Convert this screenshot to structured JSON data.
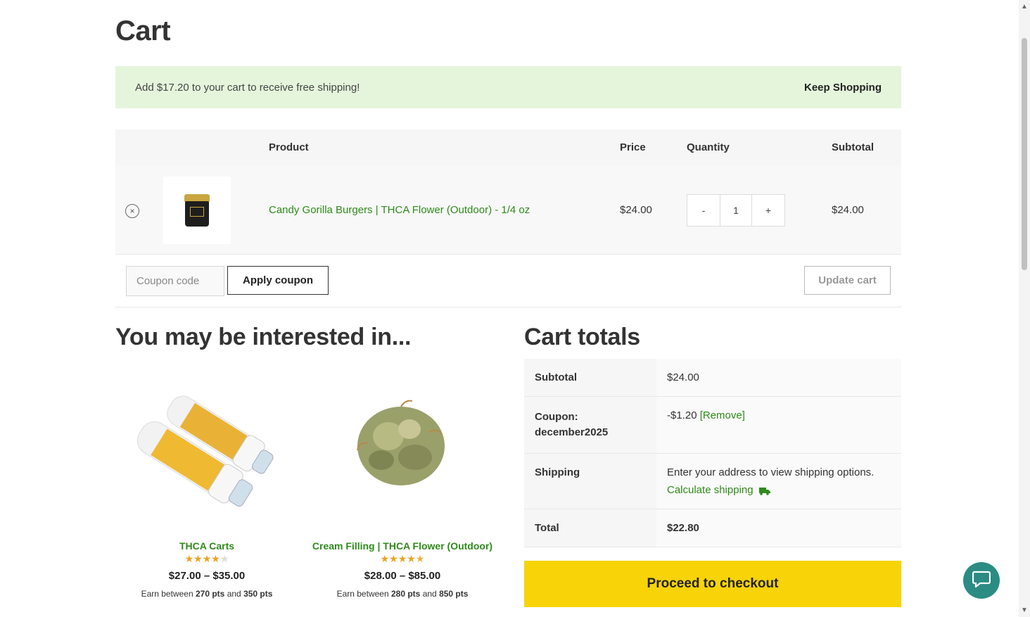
{
  "page": {
    "title": "Cart"
  },
  "notice": {
    "text": "Add $17.20 to your cart to receive free shipping!",
    "link": "Keep Shopping"
  },
  "cart": {
    "headers": {
      "product": "Product",
      "price": "Price",
      "quantity": "Quantity",
      "subtotal": "Subtotal"
    },
    "items": [
      {
        "name": "Candy Gorilla Burgers | THCA Flower (Outdoor) - 1/4 oz",
        "price": "$24.00",
        "quantity": "1",
        "subtotal": "$24.00",
        "thumbnail_icon": "product-jar-icon"
      }
    ],
    "qty_minus": "-",
    "qty_plus": "+",
    "remove_symbol": "×"
  },
  "actions": {
    "coupon_placeholder": "Coupon code",
    "apply_label": "Apply coupon",
    "update_label": "Update cart"
  },
  "related": {
    "title": "You may be interested in...",
    "products": [
      {
        "title": "THCA Carts",
        "rating": 4,
        "price": "$27.00 – $35.00",
        "points_prefix": "Earn between",
        "points_min": "270 pts",
        "points_and": "and",
        "points_max": "350 pts"
      },
      {
        "title": "Cream Filling | THCA Flower (Outdoor)",
        "rating": 4.5,
        "price": "$28.00 – $85.00",
        "points_prefix": "Earn between",
        "points_min": "280 pts",
        "points_and": "and",
        "points_max": "850 pts"
      }
    ]
  },
  "totals": {
    "title": "Cart totals",
    "subtotal_label": "Subtotal",
    "subtotal_value": "$24.00",
    "coupon_label": "Coupon: december2025",
    "coupon_value": "-$1.20",
    "coupon_remove": "[Remove]",
    "shipping_label": "Shipping",
    "shipping_text": "Enter your address to view shipping options.",
    "shipping_link": "Calculate shipping",
    "total_label": "Total",
    "total_value": "$22.80",
    "checkout_label": "Proceed to checkout"
  },
  "colors": {
    "accent_green": "#2f8a1b",
    "notice_bg": "#e5f5dc",
    "checkout_yellow": "#f7d308",
    "chat_teal": "#2b8c83"
  },
  "icons": {
    "chat": "chat-bubble-icon",
    "truck": "truck-icon",
    "remove": "remove-circle-icon"
  }
}
